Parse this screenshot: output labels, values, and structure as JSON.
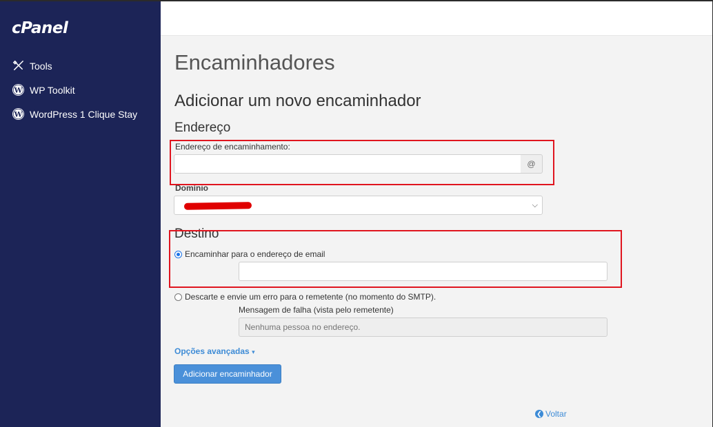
{
  "sidebar": {
    "logo": "cPanel",
    "items": [
      {
        "label": "Tools",
        "icon": "tools-icon"
      },
      {
        "label": "WP Toolkit",
        "icon": "wordpress-icon"
      },
      {
        "label": "WordPress 1 Clique Stay",
        "icon": "wordpress-icon"
      }
    ]
  },
  "page": {
    "title": "Encaminhadores",
    "subtitle": "Adicionar um novo encaminhador"
  },
  "address": {
    "heading": "Endereço",
    "forward_label": "Endereço de encaminhamento:",
    "forward_value": "",
    "at_symbol": "@",
    "domain_label": "Domínio"
  },
  "destination": {
    "heading": "Destino",
    "option_email_label": "Encaminhar para o endereço de email",
    "email_value": "",
    "option_discard_label": "Descarte e envie um erro para o remetente (no momento do SMTP).",
    "failure_label": "Mensagem de falha (vista pelo remetente)",
    "failure_placeholder": "Nenhuma pessoa no endereço."
  },
  "advanced_options": "Opções avançadas",
  "submit_label": "Adicionar encaminhador",
  "back_label": "Voltar",
  "colors": {
    "sidebar_bg": "#1c2457",
    "primary_button": "#4a90d9",
    "link": "#3d8bd6",
    "annotation": "#e0141e"
  }
}
